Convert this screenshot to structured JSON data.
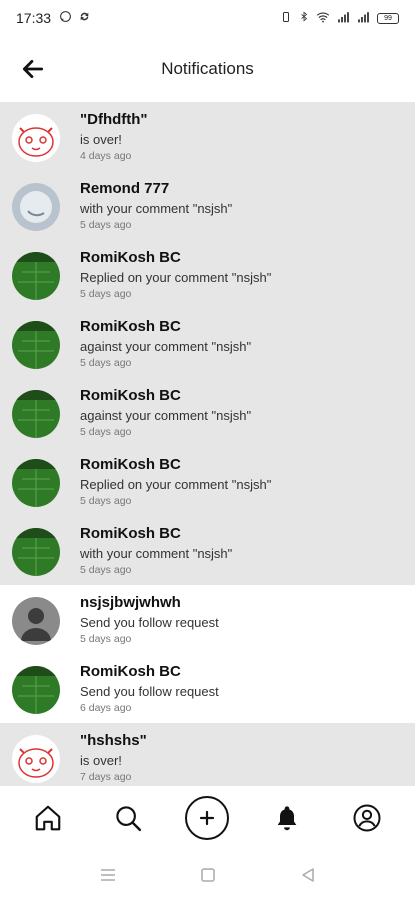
{
  "status_bar": {
    "time": "17:33",
    "battery": "99",
    "left_icons": [
      "whatsapp-icon",
      "sync-icon"
    ],
    "right_icons": [
      "vibrate-icon",
      "bluetooth-icon",
      "wifi-icon",
      "signal-icon",
      "signal-icon"
    ]
  },
  "header": {
    "title": "Notifications",
    "back_icon": "arrow-left-icon"
  },
  "notifications": [
    {
      "name": "\"Dfhdfth\"",
      "message": "is over!",
      "time": "4 days ago",
      "avatar": "cat-illustration",
      "highlighted": true
    },
    {
      "name": "Remond 777",
      "message": "with your comment \"nsjsh\"",
      "time": "5 days ago",
      "avatar": "moon-photo",
      "highlighted": true
    },
    {
      "name": "RomiKosh BC",
      "message": "Replied on your comment \"nsjsh\"",
      "time": "5 days ago",
      "avatar": "green-field-photo",
      "highlighted": true
    },
    {
      "name": "RomiKosh BC",
      "message": "against your comment \"nsjsh\"",
      "time": "5 days ago",
      "avatar": "green-field-photo",
      "highlighted": true
    },
    {
      "name": "RomiKosh BC",
      "message": "against your comment \"nsjsh\"",
      "time": "5 days ago",
      "avatar": "green-field-photo",
      "highlighted": true
    },
    {
      "name": "RomiKosh BC",
      "message": "Replied on your comment \"nsjsh\"",
      "time": "5 days ago",
      "avatar": "green-field-photo",
      "highlighted": true
    },
    {
      "name": "RomiKosh BC",
      "message": "with your comment \"nsjsh\"",
      "time": "5 days ago",
      "avatar": "green-field-photo",
      "highlighted": true
    },
    {
      "name": "nsjsjbwjwhwh",
      "message": "Send you follow request",
      "time": "5 days ago",
      "avatar": "default-user",
      "highlighted": false
    },
    {
      "name": "RomiKosh BC",
      "message": "Send you follow request",
      "time": "6 days ago",
      "avatar": "green-field-photo",
      "highlighted": false
    },
    {
      "name": "\"hshshs\"",
      "message": "is over!",
      "time": "7 days ago",
      "avatar": "cat-illustration",
      "highlighted": true
    }
  ],
  "bottom_nav": [
    "home-icon",
    "search-icon",
    "add-circle-icon",
    "bell-icon",
    "profile-icon"
  ],
  "system_nav": [
    "menu-icon",
    "square-icon",
    "back-triangle-icon"
  ],
  "colors": {
    "highlight_bg": "#e6e6e6",
    "text": "#111111",
    "muted": "#777777"
  }
}
